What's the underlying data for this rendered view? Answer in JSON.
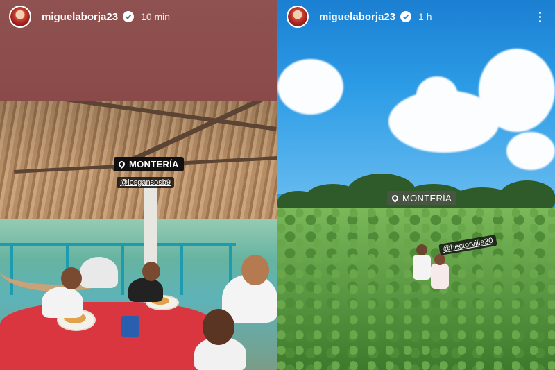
{
  "stories": [
    {
      "username": "miguelaborja23",
      "time": "10 min",
      "location": "MONTERÍA",
      "mention": "@losgansosb9",
      "colors": {
        "background": "#8e4f4f"
      }
    },
    {
      "username": "miguelaborja23",
      "time": "1 h",
      "location": "MONTERÍA",
      "mention": "@hectorvilla30",
      "colors": {
        "sky": "#2a9be0",
        "field": "#5f9c45"
      }
    }
  ],
  "icons": {
    "verified": "verified-badge-icon",
    "location": "location-pin-icon",
    "more": "more-options-icon"
  }
}
